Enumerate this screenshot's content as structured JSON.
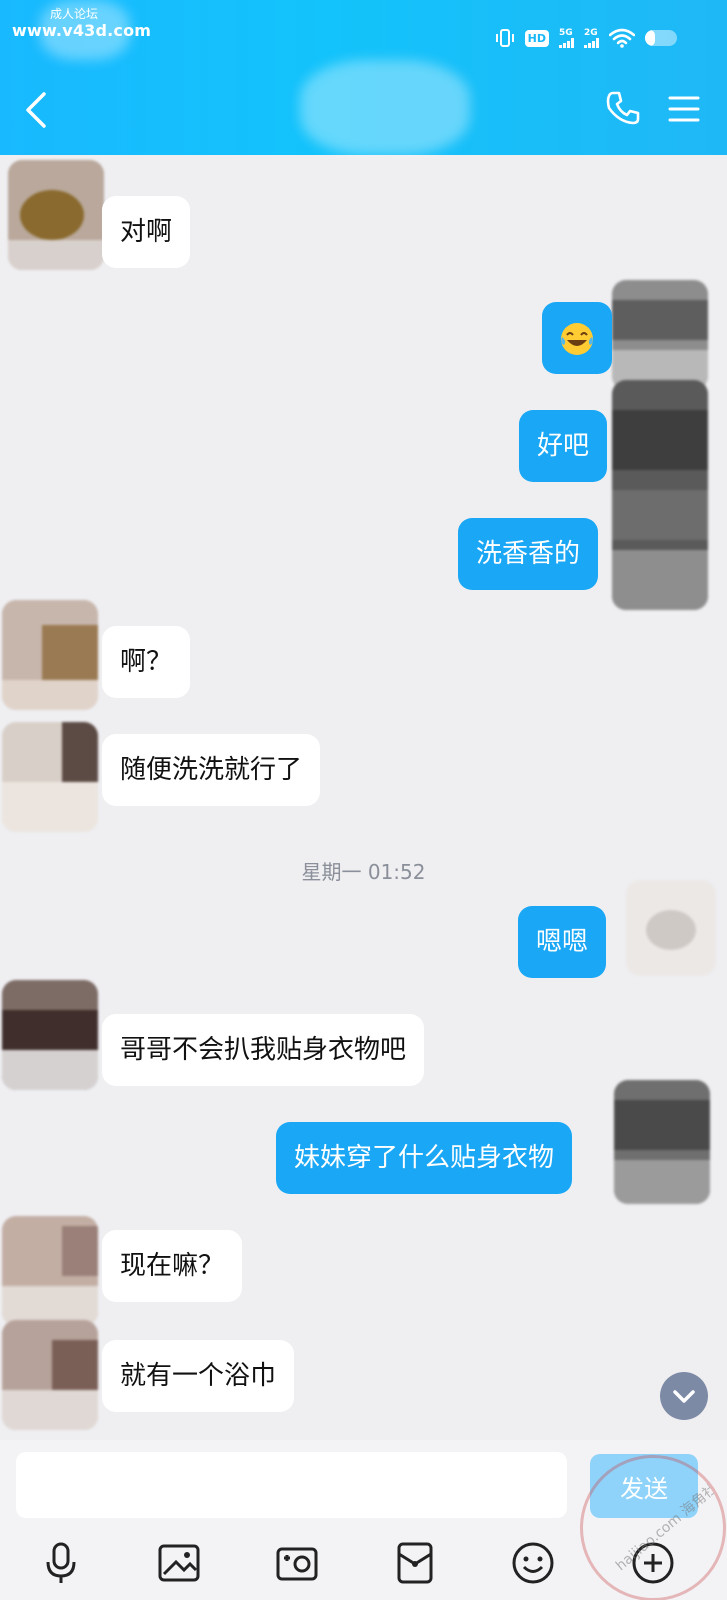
{
  "status_bar": {
    "watermark_cn": "成人论坛",
    "watermark_url": "www.v43d.com",
    "hd_label": "HD",
    "sim1_label": "5G",
    "sim2_label": "2G",
    "battery_level": 0.3
  },
  "header": {
    "back_icon": "chevron-left-icon",
    "call_icon": "phone-icon",
    "menu_icon": "hamburger-menu-icon"
  },
  "messages": [
    {
      "side": "in",
      "text": "对啊"
    },
    {
      "side": "out",
      "type": "emoji",
      "emoji": "tears-of-joy-emoji"
    },
    {
      "side": "out",
      "text": "好吧"
    },
    {
      "side": "out",
      "text": "洗香香的"
    },
    {
      "side": "in",
      "text": "啊？"
    },
    {
      "side": "in",
      "text": "随便洗洗就行了"
    },
    {
      "side": "out",
      "text": "嗯嗯"
    },
    {
      "side": "in",
      "text": "哥哥不会扒我贴身衣物吧"
    },
    {
      "side": "out",
      "text": "妹妹穿了什么贴身衣物"
    },
    {
      "side": "in",
      "text": "现在嘛？"
    },
    {
      "side": "in",
      "text": "就有一个浴巾"
    }
  ],
  "timestamp": "星期一 01:52",
  "input": {
    "value": "",
    "placeholder": "",
    "send_label": "发送"
  },
  "watermark_bottom": "haijiao.com 海角社区",
  "toolbar": [
    {
      "icon": "microphone-icon"
    },
    {
      "icon": "image-icon"
    },
    {
      "icon": "camera-icon"
    },
    {
      "icon": "red-packet-icon"
    },
    {
      "icon": "emoji-icon"
    },
    {
      "icon": "plus-icon"
    }
  ],
  "colors": {
    "header": "#19b9ff",
    "outgoing_bubble": "#1aa7f5",
    "incoming_bubble": "#ffffff",
    "background": "#efeff2"
  }
}
